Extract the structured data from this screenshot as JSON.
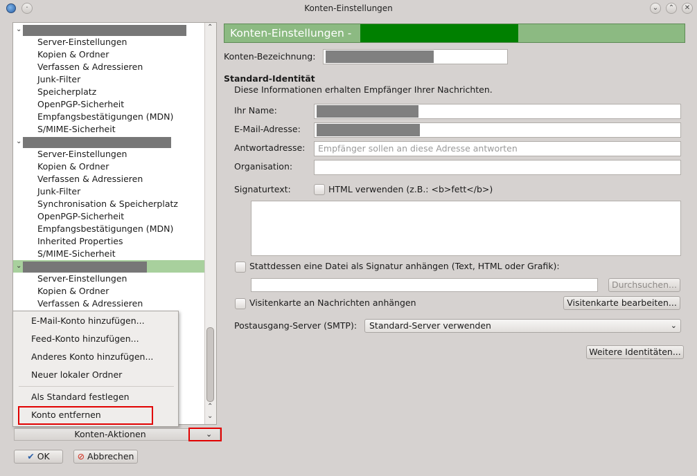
{
  "window": {
    "title": "Konten-Einstellungen"
  },
  "tree": {
    "accounts": [
      {
        "name": "",
        "expanded": true,
        "selected": false,
        "children": [
          "Server-Einstellungen",
          "Kopien & Ordner",
          "Verfassen & Adressieren",
          "Junk-Filter",
          "Speicherplatz",
          "OpenPGP-Sicherheit",
          "Empfangsbestätigungen (MDN)",
          "S/MIME-Sicherheit"
        ]
      },
      {
        "name": "",
        "expanded": true,
        "selected": false,
        "children": [
          "Server-Einstellungen",
          "Kopien & Ordner",
          "Verfassen & Adressieren",
          "Junk-Filter",
          "Synchronisation & Speicherplatz",
          "OpenPGP-Sicherheit",
          "Empfangsbestätigungen (MDN)",
          "Inherited Properties",
          "S/MIME-Sicherheit"
        ]
      },
      {
        "name": "",
        "expanded": true,
        "selected": true,
        "children": [
          "Server-Einstellungen",
          "Kopien & Ordner",
          "Verfassen & Adressieren"
        ]
      }
    ]
  },
  "menu": {
    "items": [
      "E-Mail-Konto hinzufügen...",
      "Feed-Konto hinzufügen...",
      "Anderes Konto hinzufügen...",
      "Neuer lokaler Ordner",
      "Als Standard festlegen",
      "Konto entfernen"
    ]
  },
  "actions": {
    "label": "Konten-Aktionen"
  },
  "buttons": {
    "ok": "OK",
    "cancel": "Abbrechen"
  },
  "panel": {
    "header": "Konten-Einstellungen -",
    "account_name_label": "Konten-Bezeichnung:",
    "identity_title": "Standard-Identität",
    "identity_desc": "Diese Informationen erhalten Empfänger Ihrer Nachrichten.",
    "name_label": "Ihr Name:",
    "email_label": "E-Mail-Adresse:",
    "reply_label": "Antwortadresse:",
    "reply_placeholder": "Empfänger sollen an diese Adresse antworten",
    "org_label": "Organisation:",
    "sig_label": "Signaturtext:",
    "html_label": "HTML verwenden (z.B.: <b>fett</b>)",
    "attach_sig_label": "Stattdessen eine Datei als Signatur anhängen (Text, HTML oder Grafik):",
    "browse": "Durchsuchen...",
    "vcard_label": "Visitenkarte an Nachrichten anhängen",
    "vcard_edit": "Visitenkarte bearbeiten...",
    "smtp_label": "Postausgang-Server (SMTP):",
    "smtp_value": "Standard-Server verwenden",
    "more_identities": "Weitere Identitäten..."
  },
  "colors": {
    "selection": "#a8d09d",
    "header_bg": "#8cba82",
    "header_bar": "#008000",
    "highlight_box": "#e10000"
  }
}
